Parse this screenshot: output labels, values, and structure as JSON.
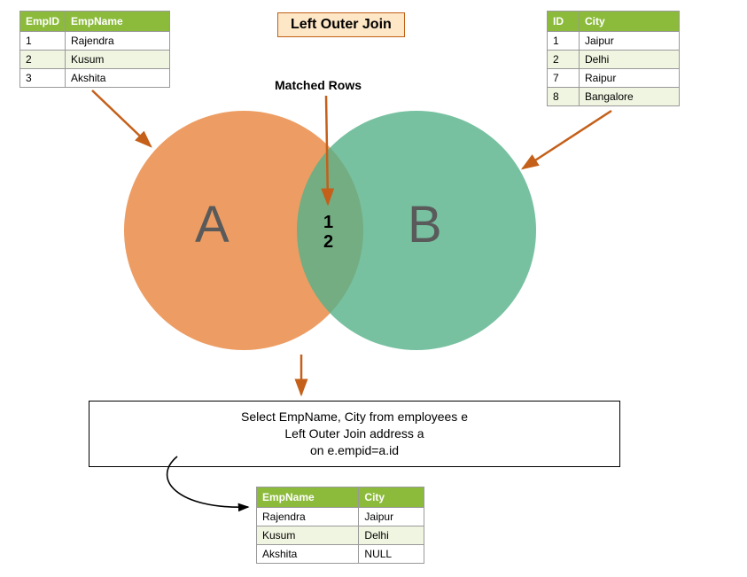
{
  "title": "Left Outer Join",
  "matched_label": "Matched Rows",
  "venn": {
    "labelA": "A",
    "labelB": "B",
    "mid1": "1",
    "mid2": "2"
  },
  "tableA": {
    "headers": [
      "EmpID",
      "EmpName"
    ],
    "rows": [
      [
        "1",
        "Rajendra"
      ],
      [
        "2",
        "Kusum"
      ],
      [
        "3",
        "Akshita"
      ]
    ]
  },
  "tableB": {
    "headers": [
      "ID",
      "City"
    ],
    "rows": [
      [
        "1",
        "Jaipur"
      ],
      [
        "2",
        "Delhi"
      ],
      [
        "7",
        "Raipur"
      ],
      [
        "8",
        "Bangalore"
      ]
    ]
  },
  "sql": {
    "line1": "Select EmpName, City from employees e",
    "line2": "Left Outer Join address a",
    "line3": "on e.empid=a.id"
  },
  "result": {
    "headers": [
      "EmpName",
      "City"
    ],
    "rows": [
      [
        "Rajendra",
        "Jaipur"
      ],
      [
        "Kusum",
        "Delhi"
      ],
      [
        "Akshita",
        "NULL"
      ]
    ]
  }
}
